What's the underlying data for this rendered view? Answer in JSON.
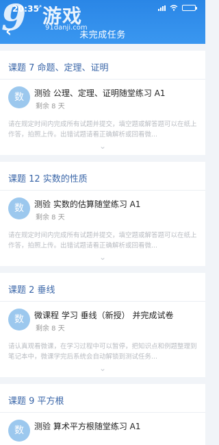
{
  "status": {
    "time": "20:35",
    "location_arrow": "↗"
  },
  "header": {
    "back_icon": "chevron-left-icon",
    "title": "未完成任务"
  },
  "watermark": {
    "logo": "9",
    "text": "游戏",
    "url": "91danji.com"
  },
  "cards": [
    {
      "section": "课题 7 命题、定理、证明",
      "avatar": "数",
      "task": "测验 公理、定理、证明随堂练习 A1",
      "remaining": "剩余 8 天",
      "desc": "请在规定时间内完成所有试题并提交，填空题或解答题可以在纸上作答，拍照上传。出错试题请看正确解析或回看微..."
    },
    {
      "section": "课题 12 实数的性质",
      "avatar": "数",
      "task": "测验 实数的估算随堂练习 A1",
      "remaining": "剩余 8 天",
      "desc": "请在规定时间内完成所有试题并提交，填空题或解答题可以在纸上作答，拍照上传。出错试题请看正确解析或回看微..."
    },
    {
      "section": "课题 2 垂线",
      "avatar": "数",
      "task": "微课程 学习 垂线（新授） 并完成试卷",
      "remaining": "剩余 8 天",
      "desc": "请认真观看微课，在学习过程中可以暂停，把知识点和例题整理到笔记本中，微课学完后系统会自动解锁到测试任务..."
    },
    {
      "section": "课题 9 平方根",
      "avatar": "数",
      "task": "测验 算术平方根随堂练习 A1",
      "remaining": "",
      "desc": ""
    }
  ]
}
